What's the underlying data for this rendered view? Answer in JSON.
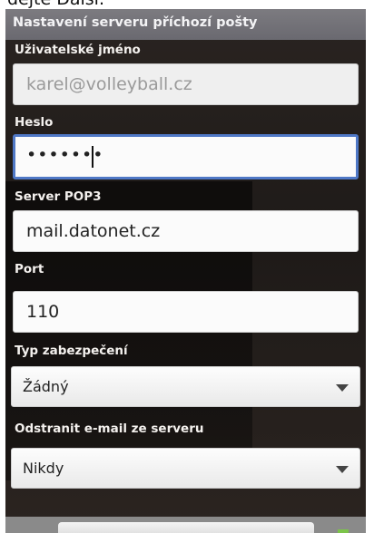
{
  "caption": {
    "text": "dejte Další."
  },
  "title_bar": {
    "title": "Nastavení serveru příchozí pošty"
  },
  "form": {
    "username": {
      "label": "Uživatelské jméno",
      "value": "karel@volleyball.cz"
    },
    "password": {
      "label": "Heslo",
      "value": "•••••••"
    },
    "pop3_server": {
      "label": "Server POP3",
      "value": "mail.datonet.cz"
    },
    "port": {
      "label": "Port",
      "value": "110"
    },
    "security_type": {
      "label": "Typ zabezpečení",
      "selected": "Žádný"
    },
    "delete_email": {
      "label": "Odstranit e-mail ze serveru",
      "selected": "Nikdy"
    }
  },
  "colors": {
    "title_bar": "#6f6e75",
    "focus_border": "#4f78c6",
    "background": "#231e1b"
  },
  "icons": {
    "dropdown": "triangle-down-icon"
  }
}
